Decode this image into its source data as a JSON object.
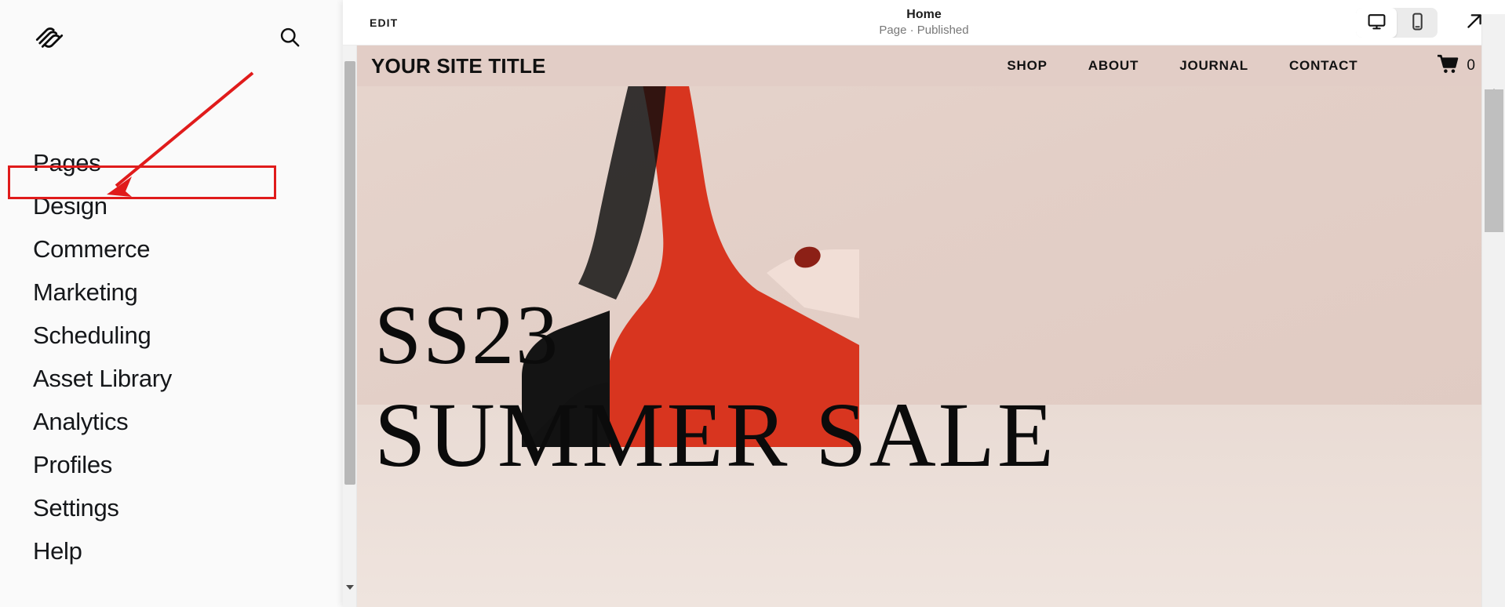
{
  "sidebar": {
    "logo_icon": "squarespace-logo",
    "search_icon": "search-icon",
    "items": [
      {
        "label": "Pages"
      },
      {
        "label": "Design"
      },
      {
        "label": "Commerce"
      },
      {
        "label": "Marketing"
      },
      {
        "label": "Scheduling"
      },
      {
        "label": "Asset Library"
      },
      {
        "label": "Analytics"
      },
      {
        "label": "Profiles"
      },
      {
        "label": "Settings"
      },
      {
        "label": "Help"
      }
    ]
  },
  "annotation": {
    "highlight_target": "Design",
    "color": "#e01b1b",
    "shape": "rectangle-with-arrow"
  },
  "preview_toolbar": {
    "edit_label": "EDIT",
    "page_title": "Home",
    "page_status": "Page · Published",
    "desktop_icon": "desktop-monitor-icon",
    "mobile_icon": "mobile-phone-icon",
    "open_external_icon": "arrow-up-right-icon",
    "active_device": "desktop"
  },
  "site": {
    "title": "YOUR SITE TITLE",
    "nav": [
      "SHOP",
      "ABOUT",
      "JOURNAL",
      "CONTACT"
    ],
    "cart_icon": "shopping-cart-icon",
    "cart_count": "0",
    "hero": {
      "line1": "SS23",
      "line2": "SUMMER SALE",
      "background_color": "#e2cdc6",
      "accent_color": "#d8351f"
    }
  },
  "scrollbars": {
    "left_up_icon": "triangle-up-icon",
    "left_down_icon": "triangle-down-icon",
    "right_up_icon": "triangle-up-icon"
  }
}
